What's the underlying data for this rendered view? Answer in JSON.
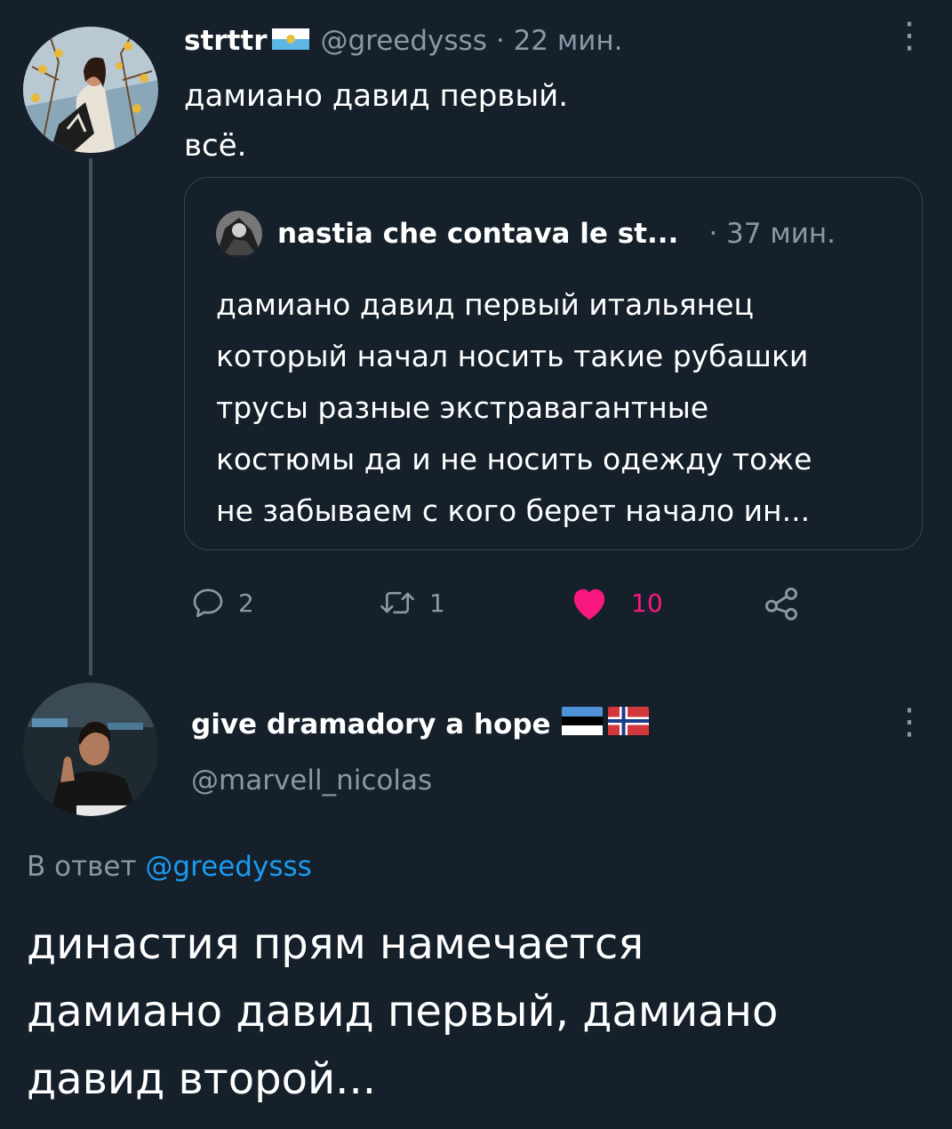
{
  "tweet1": {
    "display_name": "strttr",
    "handle": "@greedysss",
    "time": "· 22 мин.",
    "text_line1": "дамиано давид первый.",
    "text_line2": "всё.",
    "quote": {
      "display_name": "nastia che contava le st...",
      "time": "· 37 мин.",
      "lines": [
        "дамиано давид первый итальянец",
        "который начал носить такие рубашки",
        "трусы разные экстравагантные",
        "костюмы да и не носить одежду тоже",
        "не забываем с кого берет начало ин..."
      ]
    },
    "actions": {
      "replies": "2",
      "retweets": "1",
      "likes": "10"
    },
    "flag_icon": "san-marino-flag-icon"
  },
  "tweet2": {
    "display_name": "give dramadory a hope",
    "handle": "@marvell_nicolas",
    "reply_prefix": "В ответ",
    "reply_handle": "@greedysss",
    "text_lines": [
      "династия прям намечается",
      "дамиано давид первый, дамиано",
      "давид второй..."
    ],
    "flag_icons": [
      "estonia-flag-icon",
      "norway-flag-icon"
    ]
  },
  "colors": {
    "background": "#15202b",
    "muted": "#8899a6",
    "link": "#1d9bf0",
    "like": "#f91880",
    "border": "#38444d"
  }
}
